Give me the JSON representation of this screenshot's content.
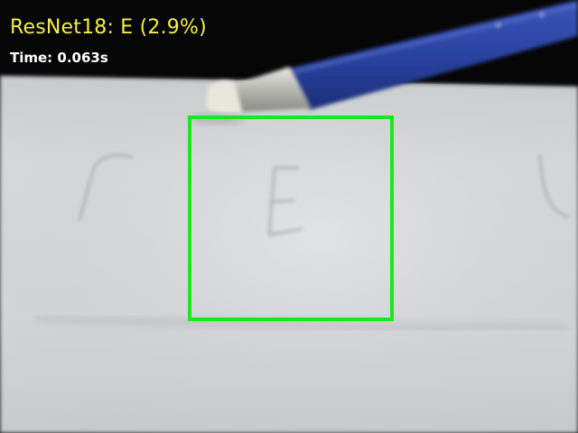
{
  "overlay": {
    "model": "ResNet18",
    "prediction": "E",
    "confidence": "2.9%",
    "title": "ResNet18: E (2.9%)",
    "time_label": "Time: 0.063s",
    "title_color": "#f4ef46",
    "time_color": "#ffffff"
  },
  "detection_box": {
    "color": "#1ee61e"
  },
  "scene": {
    "paper_color": "#d7dadb",
    "pencil_color": "#2b45a6"
  }
}
